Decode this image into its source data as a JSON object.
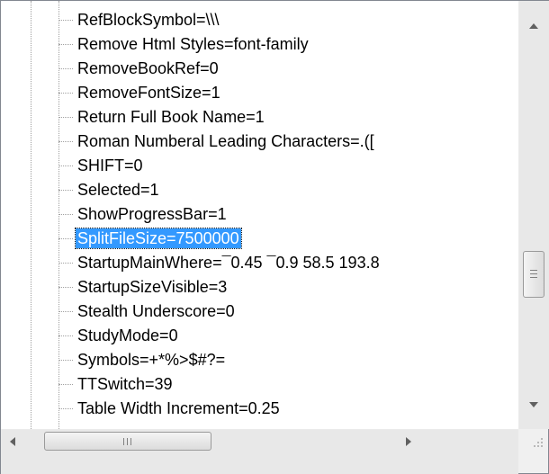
{
  "tree": {
    "items": [
      {
        "label": "RefBlockSymbol=\\\\\\"
      },
      {
        "label": "Remove Html Styles=font-family"
      },
      {
        "label": "RemoveBookRef=0"
      },
      {
        "label": "RemoveFontSize=1"
      },
      {
        "label": "Return Full Book Name=1"
      },
      {
        "label": "Roman Numberal Leading Characters=.(["
      },
      {
        "label": "SHIFT=0"
      },
      {
        "label": "Selected=1"
      },
      {
        "label": "ShowProgressBar=1"
      },
      {
        "label": "SplitFileSize=7500000",
        "selected": true
      },
      {
        "label": "StartupMainWhere=¯0.45 ¯0.9 58.5 193.8"
      },
      {
        "label": "StartupSizeVisible=3"
      },
      {
        "label": "Stealth Underscore=0"
      },
      {
        "label": "StudyMode=0"
      },
      {
        "label": "Symbols=+*%>$#?="
      },
      {
        "label": "TTSwitch=39"
      },
      {
        "label": "Table Width Increment=0.25"
      }
    ]
  },
  "colors": {
    "selection": "#3399ff",
    "border": "#828790"
  },
  "icons": {
    "scroll_up": "up-arrow-icon",
    "scroll_down": "down-arrow-icon",
    "scroll_left": "left-arrow-icon",
    "scroll_right": "right-arrow-icon",
    "size_grip": "size-grip-icon"
  }
}
